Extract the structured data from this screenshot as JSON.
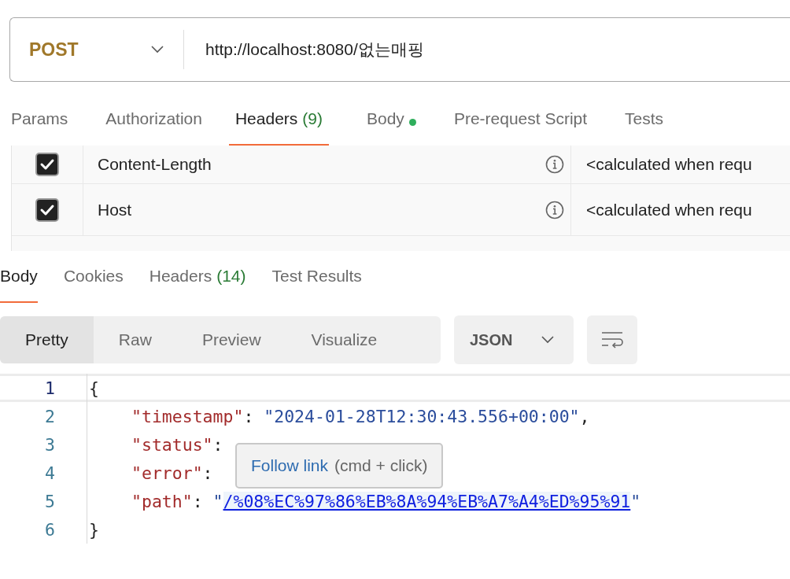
{
  "request": {
    "method": "POST",
    "url": "http://localhost:8080/없는매핑"
  },
  "request_tabs": [
    {
      "label": "Params",
      "selected": false,
      "dot": false
    },
    {
      "label": "Authorization",
      "selected": false,
      "dot": false
    },
    {
      "label": "Headers",
      "count": "(9)",
      "selected": true,
      "dot": false
    },
    {
      "label": "Body",
      "selected": false,
      "dot": true
    },
    {
      "label": "Pre-request Script",
      "selected": false,
      "dot": false
    },
    {
      "label": "Tests",
      "selected": false,
      "dot": false
    }
  ],
  "headers": [
    {
      "checked": true,
      "key": "Content-Length",
      "value": "<calculated when requ"
    },
    {
      "checked": true,
      "key": "Host",
      "value": "<calculated when requ"
    }
  ],
  "response_tabs": [
    {
      "label": "Body",
      "selected": true
    },
    {
      "label": "Cookies",
      "selected": false
    },
    {
      "label": "Headers",
      "count": "(14)",
      "selected": false
    },
    {
      "label": "Test Results",
      "selected": false
    }
  ],
  "view_modes": [
    {
      "label": "Pretty",
      "selected": true
    },
    {
      "label": "Raw",
      "selected": false
    },
    {
      "label": "Preview",
      "selected": false
    },
    {
      "label": "Visualize",
      "selected": false
    }
  ],
  "format": "JSON",
  "code": [
    {
      "number": "1",
      "indent": false,
      "tokens": [
        {
          "text": "{",
          "kind": "punct"
        }
      ]
    },
    {
      "number": "2",
      "indent": true,
      "tokens": [
        {
          "text": "\"timestamp\"",
          "kind": "key"
        },
        {
          "text": ": ",
          "kind": "punct"
        },
        {
          "text": "\"2024-01-28T12:30:43.556+00:00\"",
          "kind": "string"
        },
        {
          "text": ",",
          "kind": "punct"
        }
      ]
    },
    {
      "number": "3",
      "indent": true,
      "tokens": [
        {
          "text": "\"status\"",
          "kind": "key"
        },
        {
          "text": ":",
          "kind": "punct"
        }
      ]
    },
    {
      "number": "4",
      "indent": true,
      "tokens": [
        {
          "text": "\"error\"",
          "kind": "key"
        },
        {
          "text": ":",
          "kind": "punct"
        }
      ]
    },
    {
      "number": "5",
      "indent": true,
      "tokens": [
        {
          "text": "\"path\"",
          "kind": "key"
        },
        {
          "text": ": ",
          "kind": "punct"
        },
        {
          "text": "\"",
          "kind": "string"
        },
        {
          "text": "/%08%EC%97%86%EB%8A%94%EB%A7%A4%ED%95%91",
          "kind": "link"
        },
        {
          "text": "\"",
          "kind": "string"
        }
      ]
    },
    {
      "number": "6",
      "indent": false,
      "tokens": [
        {
          "text": "}",
          "kind": "punct"
        }
      ]
    }
  ],
  "tooltip": {
    "link": "Follow link",
    "hint": "(cmd + click)"
  }
}
